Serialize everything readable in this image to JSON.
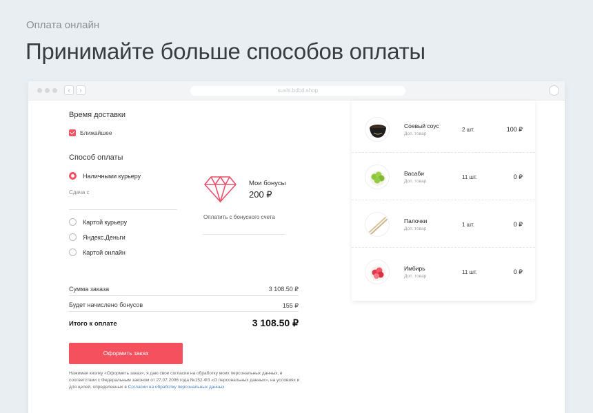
{
  "header": {
    "eyebrow": "Оплата онлайн",
    "headline": "Принимайте больше способов оплаты"
  },
  "browser": {
    "url": "sushi.bdbd.shop",
    "back_glyph": "‹",
    "forward_glyph": "›"
  },
  "delivery": {
    "title": "Время доставки",
    "option_label": "Ближайшее",
    "checked": true
  },
  "payment": {
    "title": "Способ оплаты",
    "change_label": "Сдача с",
    "options": [
      {
        "label": "Наличными курьеру",
        "selected": true
      },
      {
        "label": "Картой курьеру",
        "selected": false
      },
      {
        "label": "Яндекс.Деньги",
        "selected": false
      },
      {
        "label": "Картой онлайн",
        "selected": false
      }
    ]
  },
  "bonus": {
    "icon": "diamond-icon",
    "label": "Мои бонусы",
    "value": "200 ₽",
    "pay_label": "Оплатить с бонусного счета"
  },
  "summary": {
    "rows": [
      {
        "label": "Сумма заказа",
        "value": "3 108.50 ₽"
      },
      {
        "label": "Будет начислено бонусов",
        "value": "155 ₽"
      }
    ],
    "total_label": "Итого к оплате",
    "total_value": "3 108.50 ₽"
  },
  "order_button": {
    "label": "Оформить заказ"
  },
  "consent": {
    "text": "Нажимая кнопку «Оформить заказ», я даю свое согласие на обработку моих персональных данных, в соответствии с Федеральным законом от 27.07.2006 года №152-ФЗ «О персональных данных», на условиях и для целей, определенных в ",
    "link": "Согласии на обработку персональных данных"
  },
  "cart": {
    "items": [
      {
        "name": "Соевый соус",
        "sub": "Доп. товар",
        "qty": "2 шт.",
        "price": "100 ₽",
        "icon": "soy-sauce-bowl-icon"
      },
      {
        "name": "Васаби",
        "sub": "Доп. товар",
        "qty": "11 шт.",
        "price": "0 ₽",
        "icon": "wasabi-icon"
      },
      {
        "name": "Палочки",
        "sub": "Доп. товар",
        "qty": "1 шт.",
        "price": "0 ₽",
        "icon": "chopsticks-icon"
      },
      {
        "name": "Имбирь",
        "sub": "Доп. товар",
        "qty": "11 шт.",
        "price": "0 ₽",
        "icon": "ginger-icon"
      }
    ]
  },
  "colors": {
    "accent": "#f5505d",
    "background": "#e8eef2",
    "link": "#4a7fc0"
  }
}
